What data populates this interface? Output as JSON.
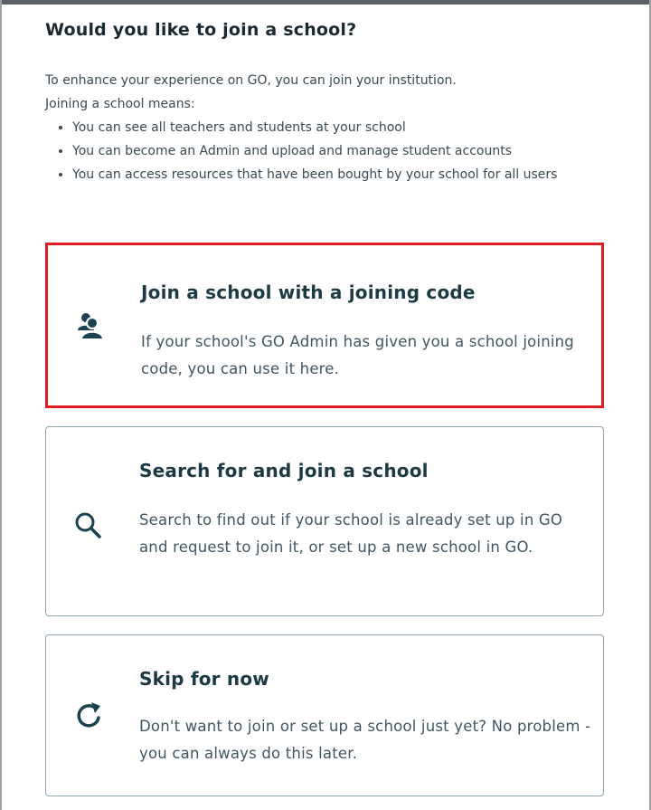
{
  "heading": "Would you like to join a school?",
  "intro": {
    "line1": "To enhance your experience on GO, you can join your institution.",
    "line2": "Joining a school means:",
    "bullets": [
      "You can see all teachers and students at your school",
      "You can become an Admin and upload and manage student accounts",
      "You can access resources that have been bought by your school for all users"
    ]
  },
  "options": [
    {
      "title": "Join a school with a joining code",
      "description": "If your school's GO Admin has given you a school joining code, you can use it here.",
      "icon": "people-icon"
    },
    {
      "title": "Search for and join a school",
      "description": "Search to find out if your school is already set up in GO and request to join it, or set up a new school in GO.",
      "icon": "search-icon"
    },
    {
      "title": "Skip for now",
      "description": "Don't want to join or set up a school just yet? No problem - you can always do this later.",
      "icon": "refresh-icon"
    }
  ],
  "colors": {
    "highlight_border": "#e01f25",
    "card_border": "#8ea3ab",
    "icon": "#1a4250",
    "text": "#1f3a44"
  }
}
